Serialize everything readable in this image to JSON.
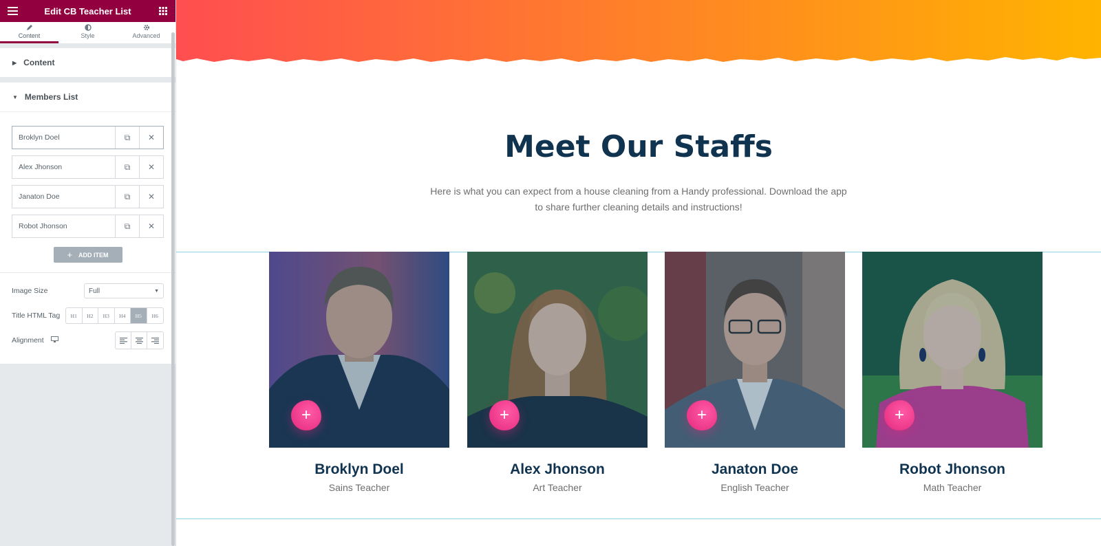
{
  "panel": {
    "title": "Edit CB Teacher List",
    "tabs": [
      {
        "label": "Content",
        "icon": "pencil-icon"
      },
      {
        "label": "Style",
        "icon": "half-circle-icon"
      },
      {
        "label": "Advanced",
        "icon": "gear-icon"
      }
    ],
    "sections": {
      "content": "Content",
      "members": "Members List"
    },
    "members": [
      "Broklyn Doel",
      "Alex Jhonson",
      "Janaton Doe",
      "Robot Jhonson"
    ],
    "add_item_label": "ADD ITEM",
    "controls": {
      "image_size_label": "Image Size",
      "image_size_value": "Full",
      "title_tag_label": "Title HTML Tag",
      "title_tags": [
        "H1",
        "H2",
        "H3",
        "H4",
        "H5",
        "H6"
      ],
      "title_tag_selected": "H5",
      "alignment_label": "Alignment"
    }
  },
  "preview": {
    "heading": "Meet Our Staffs",
    "subtext": "Here is what you can expect from a house cleaning from a Handy professional. Download the app to share further cleaning details and instructions!",
    "colors": {
      "banner_start": "#ff4e50",
      "banner_end": "#ffb400",
      "heading": "#10334f",
      "accent": "#e4287d",
      "panel_header": "#93003f"
    },
    "staff": [
      {
        "name": "Broklyn Doel",
        "role": "Sains Teacher"
      },
      {
        "name": "Alex Jhonson",
        "role": "Art Teacher"
      },
      {
        "name": "Janaton Doe",
        "role": "English Teacher"
      },
      {
        "name": "Robot Jhonson",
        "role": "Math Teacher"
      }
    ]
  }
}
